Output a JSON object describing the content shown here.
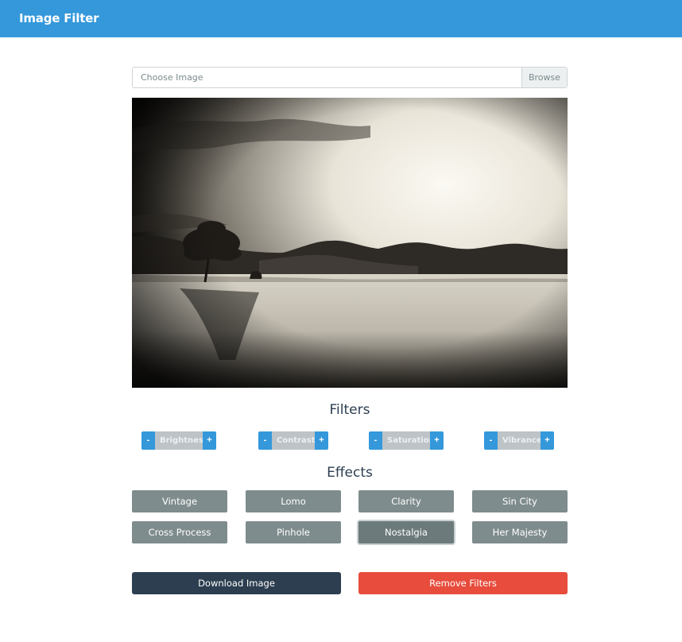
{
  "navbar": {
    "brand": "Image Filter"
  },
  "file_input": {
    "placeholder": "Choose Image",
    "browse_label": "Browse"
  },
  "image": {
    "description": "sepia lake landscape with lone tree"
  },
  "filters": {
    "title": "Filters",
    "items": [
      {
        "minus": "-",
        "label": "Brightness",
        "plus": "+"
      },
      {
        "minus": "-",
        "label": "Contrast",
        "plus": "+"
      },
      {
        "minus": "-",
        "label": "Saturation",
        "plus": "+"
      },
      {
        "minus": "-",
        "label": "Vibrance",
        "plus": "+"
      }
    ]
  },
  "effects": {
    "title": "Effects",
    "items": [
      "Vintage",
      "Lomo",
      "Clarity",
      "Sin City",
      "Cross Process",
      "Pinhole",
      "Nostalgia",
      "Her Majesty"
    ],
    "active": "Nostalgia"
  },
  "actions": {
    "download_label": "Download Image",
    "remove_label": "Remove Filters"
  },
  "colors": {
    "navbar": "#3498db",
    "filter_button": "#3498db",
    "filter_label": "#bdc3c7",
    "effect_button": "#7f8c8d",
    "download_button": "#2c3e50",
    "remove_button": "#e74c3c"
  }
}
